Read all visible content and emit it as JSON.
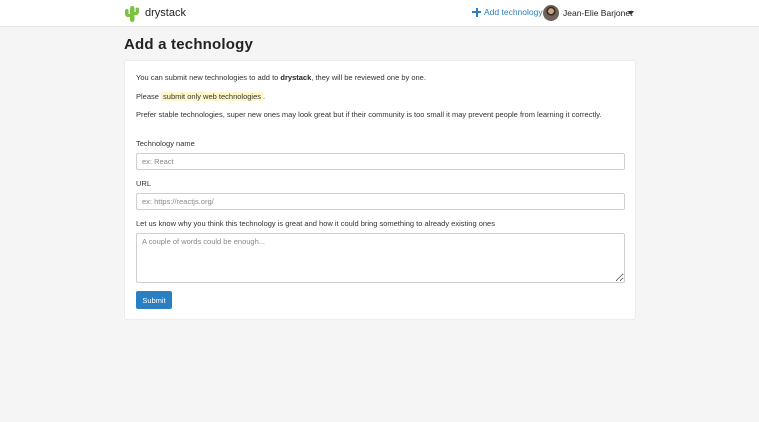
{
  "header": {
    "logo_icon": "cactus-icon",
    "brand": "drystack",
    "add_technology_label": "Add technology",
    "add_technology_icon": "plus-icon",
    "user_name": "Jean-Elie Barjonet",
    "user_menu_icon": "caret-down-icon",
    "accent_color": "#2a7ec2"
  },
  "page": {
    "title": "Add a technology"
  },
  "intro": {
    "line1_prefix": "You can submit new technologies to add to",
    "line1_brand": "drystack",
    "line1_suffix": ", they will be reviewed one by one.",
    "line2_prefix": "Please",
    "line2_highlight": "submit only web technologies",
    "line2_suffix": ".",
    "line3": "Prefer stable technologies, super new ones may look great but if their community is too small it may prevent people from learning it correctly."
  },
  "form": {
    "name_label": "Technology name",
    "name_placeholder": "ex: React",
    "name_value": "",
    "url_label": "URL",
    "url_placeholder": "ex: https://reactjs.org/",
    "url_value": "",
    "reason_label": "Let us know why you think this technology is great and how it could bring something to already existing ones",
    "reason_placeholder": "A couple of words could be enough...",
    "reason_value": "",
    "submit_label": "Submit"
  }
}
